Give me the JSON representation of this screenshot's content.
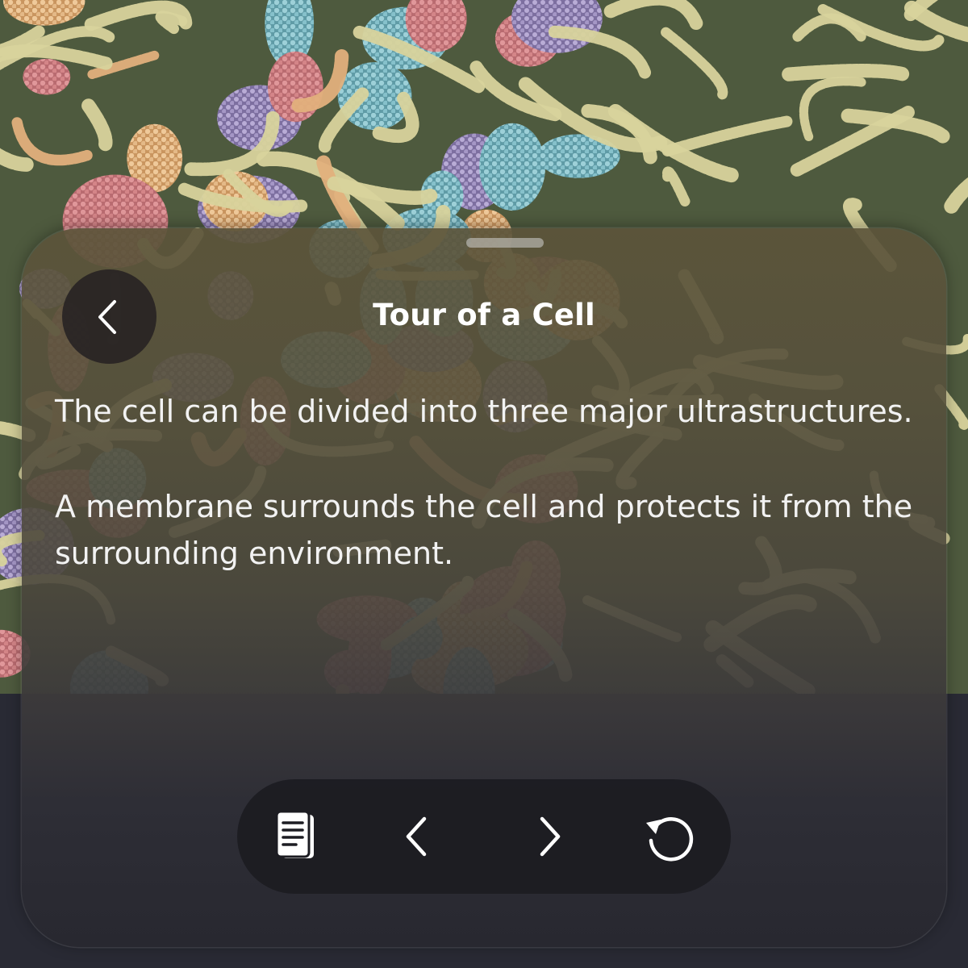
{
  "header": {
    "title": "Tour of a Cell"
  },
  "content": {
    "paragraphs": [
      "The cell can be divided into three major ultrastructures.",
      "A membrane surrounds the cell and protects it from the surrounding environment."
    ]
  },
  "toolbar": {
    "items": [
      {
        "name": "notes-button",
        "icon": "document-icon"
      },
      {
        "name": "previous-button",
        "icon": "chevron-left-icon"
      },
      {
        "name": "next-button",
        "icon": "chevron-right-icon"
      },
      {
        "name": "restart-button",
        "icon": "restart-icon"
      }
    ]
  },
  "colors": {
    "molecule_yellow": "#d9d4a0",
    "molecule_pink": "#d88a8c",
    "molecule_teal": "#7fbcc7",
    "molecule_peach": "#e3b98a",
    "molecule_lavender": "#a89ac4",
    "bottom_background": "#292a34",
    "text": "#ffffff"
  }
}
